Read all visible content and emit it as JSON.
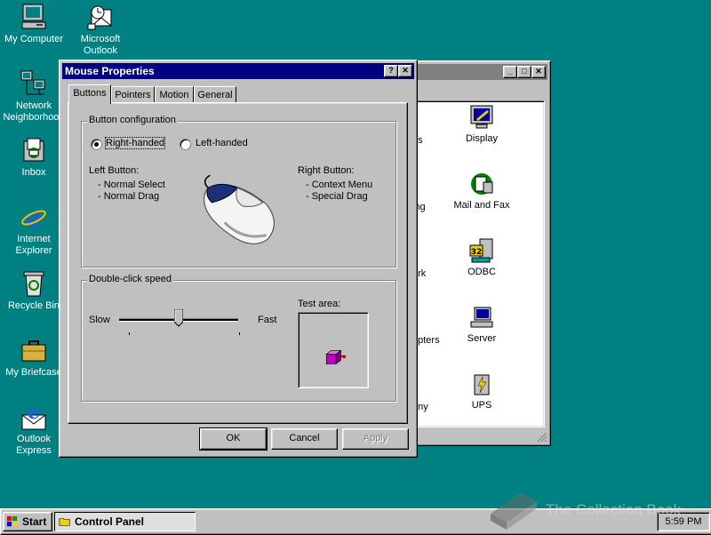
{
  "desktop": {
    "icons": [
      {
        "label": "My Computer",
        "icon": "computer-icon"
      },
      {
        "label": "Microsoft Outlook",
        "icon": "outlook-icon"
      },
      {
        "label": "Network Neighborhood",
        "icon": "network-icon"
      },
      {
        "label": "Inbox",
        "icon": "inbox-icon"
      },
      {
        "label": "Internet Explorer",
        "icon": "ie-icon"
      },
      {
        "label": "Recycle Bin",
        "icon": "recycle-bin-icon"
      },
      {
        "label": "My Briefcase",
        "icon": "briefcase-icon"
      },
      {
        "label": "Outlook Express",
        "icon": "outlook-express-icon"
      }
    ]
  },
  "control_panel": {
    "items": [
      {
        "label": "Display",
        "icon": "display-icon"
      },
      {
        "label": "Mail and Fax",
        "icon": "mail-fax-icon"
      },
      {
        "label": "ODBC",
        "icon": "odbc-icon"
      },
      {
        "label": "Server",
        "icon": "server-icon"
      },
      {
        "label": "UPS",
        "icon": "ups-icon"
      }
    ],
    "partial_items": [
      "es",
      "ing",
      "ork",
      "apters",
      "ony"
    ]
  },
  "dialog": {
    "title": "Mouse Properties",
    "help_glyph": "?",
    "close_glyph": "✕",
    "tabs": [
      "Buttons",
      "Pointers",
      "Motion",
      "General"
    ],
    "active_tab": "Buttons",
    "button_config": {
      "title": "Button configuration",
      "right_handed": "Right-handed",
      "left_handed": "Left-handed",
      "selected": "right",
      "left_button_title": "Left Button:",
      "left_button_lines": [
        "- Normal Select",
        "- Normal Drag"
      ],
      "right_button_title": "Right Button:",
      "right_button_lines": [
        "- Context Menu",
        "- Special Drag"
      ]
    },
    "double_click": {
      "title": "Double-click speed",
      "slow": "Slow",
      "fast": "Fast",
      "speed_fraction": 0.5,
      "test_area": "Test area:"
    },
    "buttons": {
      "ok": "OK",
      "cancel": "Cancel",
      "apply": "Apply"
    }
  },
  "taskbar": {
    "start": "Start",
    "task": "Control Panel",
    "clock": "5:59 PM"
  },
  "watermark": "The Collection Book",
  "colors": {
    "desktop": "#008080",
    "title_active": "#000080",
    "title_inactive": "#808080",
    "face": "#c0c0c0"
  }
}
